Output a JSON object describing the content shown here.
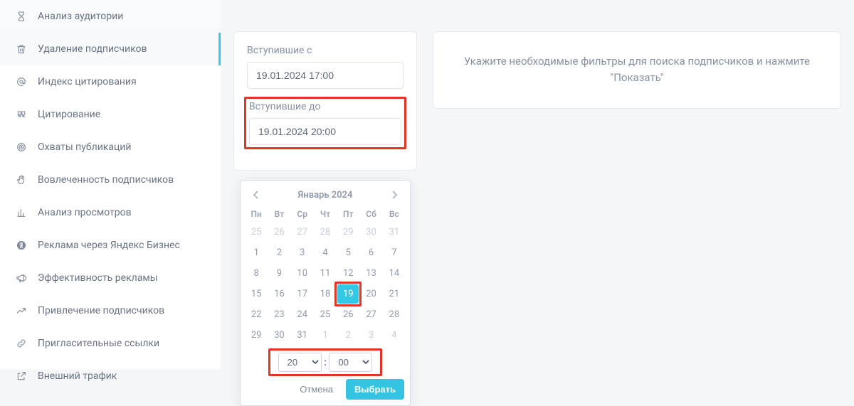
{
  "sidebar": {
    "items": [
      {
        "label": "Анализ аудитории",
        "icon": "hourglass"
      },
      {
        "label": "Удаление подписчиков",
        "icon": "trash",
        "active": true
      },
      {
        "label": "Индекс цитирования",
        "icon": "at"
      },
      {
        "label": "Цитирование",
        "icon": "quote"
      },
      {
        "label": "Охваты публикаций",
        "icon": "target"
      },
      {
        "label": "Вовлеченность подписчиков",
        "icon": "hand"
      },
      {
        "label": "Анализ просмотров",
        "icon": "chart"
      },
      {
        "label": "Реклама через Яндекс Бизнес",
        "icon": "yandex"
      },
      {
        "label": "Эффективность рекламы",
        "icon": "announce"
      },
      {
        "label": "Привлечение подписчиков",
        "icon": "trend"
      },
      {
        "label": "Пригласительные ссылки",
        "icon": "link"
      },
      {
        "label": "Внешний трафик",
        "icon": "external"
      }
    ]
  },
  "filter": {
    "from_label": "Вступившие с",
    "from_value": "19.01.2024 17:00",
    "to_label": "Вступившие до",
    "to_value": "19.01.2024 20:00"
  },
  "datepicker": {
    "title": "Январь 2024",
    "dow": [
      "Пн",
      "Вт",
      "Ср",
      "Чт",
      "Пт",
      "Сб",
      "Вс"
    ],
    "rows": [
      [
        {
          "d": "25",
          "o": 1
        },
        {
          "d": "26",
          "o": 1
        },
        {
          "d": "27",
          "o": 1
        },
        {
          "d": "28",
          "o": 1
        },
        {
          "d": "29",
          "o": 1
        },
        {
          "d": "30",
          "o": 1
        },
        {
          "d": "31",
          "o": 1
        }
      ],
      [
        {
          "d": "1"
        },
        {
          "d": "2"
        },
        {
          "d": "3"
        },
        {
          "d": "4"
        },
        {
          "d": "5"
        },
        {
          "d": "6"
        },
        {
          "d": "7"
        }
      ],
      [
        {
          "d": "8"
        },
        {
          "d": "9"
        },
        {
          "d": "10"
        },
        {
          "d": "11"
        },
        {
          "d": "12"
        },
        {
          "d": "13"
        },
        {
          "d": "14"
        }
      ],
      [
        {
          "d": "15"
        },
        {
          "d": "16"
        },
        {
          "d": "17"
        },
        {
          "d": "18"
        },
        {
          "d": "19",
          "sel": 1,
          "hl": 1
        },
        {
          "d": "20"
        },
        {
          "d": "21"
        }
      ],
      [
        {
          "d": "22"
        },
        {
          "d": "23"
        },
        {
          "d": "24"
        },
        {
          "d": "25"
        },
        {
          "d": "26"
        },
        {
          "d": "27"
        },
        {
          "d": "28"
        }
      ],
      [
        {
          "d": "29"
        },
        {
          "d": "30"
        },
        {
          "d": "31"
        },
        {
          "d": "1",
          "o": 1
        },
        {
          "d": "2",
          "o": 1
        },
        {
          "d": "3",
          "o": 1
        },
        {
          "d": "4",
          "o": 1
        }
      ]
    ],
    "hour": "20",
    "minute": "00",
    "cancel": "Отмена",
    "pick": "Выбрать"
  },
  "hint": {
    "text": "Укажите необходимые фильтры для поиска подписчиков и нажмите \"Показать\""
  }
}
